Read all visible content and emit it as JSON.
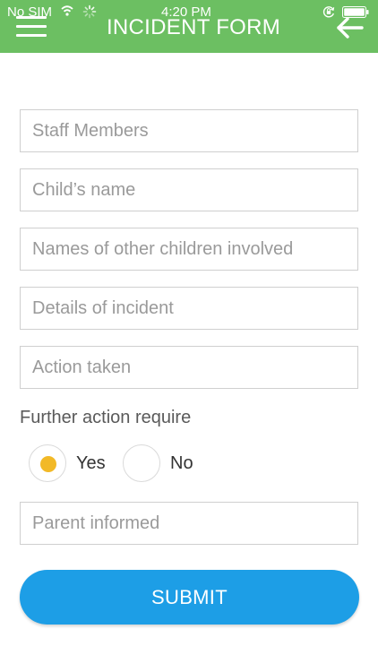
{
  "status_bar": {
    "carrier": "No SIM",
    "time": "4:20 PM"
  },
  "header": {
    "title": "INCIDENT FORM"
  },
  "form": {
    "staff_placeholder": "Staff Members",
    "child_placeholder": "Child’s name",
    "others_placeholder": "Names of other children involved",
    "details_placeholder": "Details of incident",
    "action_placeholder": "Action taken",
    "further_action_label": "Further action require",
    "yes_label": "Yes",
    "no_label": "No",
    "yes_selected": true,
    "parent_placeholder": "Parent informed",
    "submit_label": "SUBMIT"
  },
  "colors": {
    "header": "#6cbf62",
    "submit": "#1d9ee6",
    "radio_selected": "#f2b927"
  },
  "icons": [
    "menu-icon",
    "back-arrow-icon",
    "wifi-icon",
    "spinner-icon",
    "lock-rotation-icon",
    "battery-icon"
  ]
}
